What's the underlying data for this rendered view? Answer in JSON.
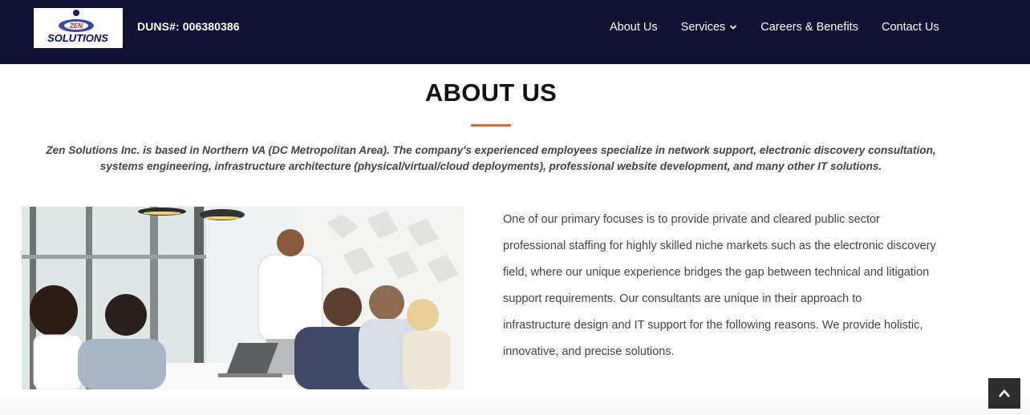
{
  "header": {
    "logo_text": "SOLUTIONS",
    "logo_badge": "ZEN",
    "duns_label": "DUNS#: 006380386",
    "nav": [
      {
        "label": "About Us"
      },
      {
        "label": "Services"
      },
      {
        "label": "Careers & Benefits"
      },
      {
        "label": "Contact Us"
      }
    ]
  },
  "main": {
    "title": "ABOUT US",
    "intro_line1": "Zen Solutions Inc. is based in Northern VA (DC Metropolitan Area). The company's experienced employees specialize in network support, electronic discovery consultation,",
    "intro_line2": "systems engineering, infrastructure architecture (physical/virtual/cloud deployments), professional website development, and many other IT solutions.",
    "body_lines": [
      "One of our primary focuses is to provide private and cleared public sector",
      "professional staffing for highly skilled niche markets such as the electronic discovery",
      "field, where our unique experience bridges the gap between technical and litigation",
      "support requirements. Our consultants are unique in their approach to",
      "infrastructure design and IT support for the following reasons. We provide holistic,",
      "innovative, and precise solutions."
    ]
  },
  "colors": {
    "header_bg": "#111133",
    "accent": "#e06a2c",
    "text": "#444444"
  },
  "icons": {
    "dropdown": "chevron-down-icon",
    "scroll_top": "chevron-up-icon"
  }
}
